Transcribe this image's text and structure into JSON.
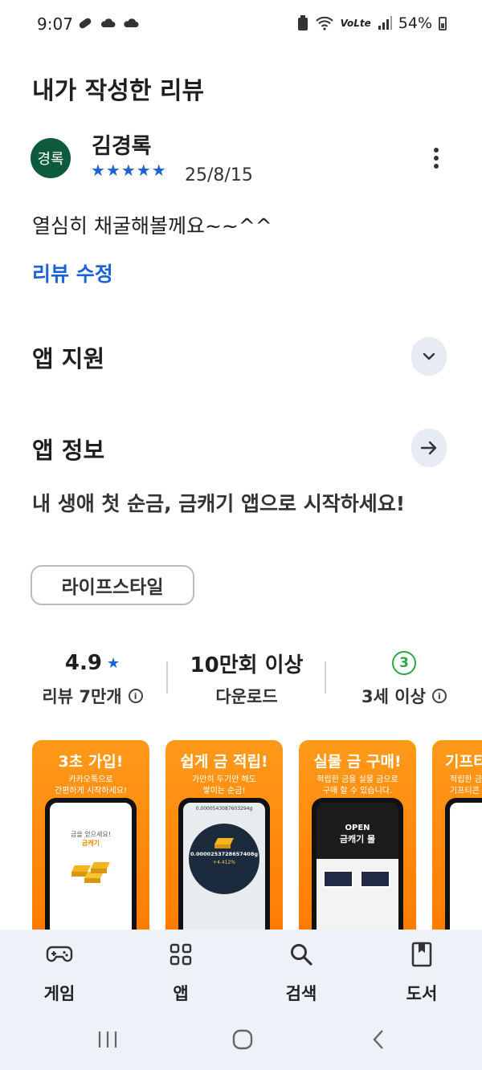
{
  "status_bar": {
    "time": "9:07",
    "network": "VoLte",
    "battery": "54%"
  },
  "page_title": "내가 작성한 리뷰",
  "review": {
    "avatar_text": "경록",
    "reviewer": "김경록",
    "rating": 5,
    "stars": "★★★★★",
    "date": "25/8/15",
    "text": "열심히 채굴해볼께요~~^^",
    "edit_label": "리뷰 수정"
  },
  "app_support": {
    "title": "앱 지원"
  },
  "app_info": {
    "title": "앱 정보",
    "description": "내 생애 첫 순금, 금캐기 앱으로 시작하세요!",
    "category": "라이프스타일"
  },
  "stats": {
    "rating": "4.9",
    "reviews": "리뷰 7만개",
    "downloads": "10만회 이상",
    "downloads_label": "다운로드",
    "age_rating": "3",
    "age_label": "3세 이상"
  },
  "screenshots": [
    {
      "title": "3초 가입!",
      "sub1": "카카오톡으로",
      "sub2": "간편하게 시작하세요!",
      "screen_line1": "금을 얻으세요!",
      "screen_line2": "금캐기"
    },
    {
      "title": "쉽게 금 적립!",
      "sub1": "가만히 두기만 해도",
      "sub2": "쌓이는 순금!",
      "screen_top": "0.0000543087603294g",
      "screen_value": "0.0000253728657408g",
      "screen_rate": "+4.412%"
    },
    {
      "title": "실물 금 구매!",
      "sub1": "적립한 금을 실물 금으로",
      "sub2": "구매 할 수 있습니다.",
      "screen_open": "OPEN",
      "screen_mall": "금캐기 몰"
    },
    {
      "title": "기프티",
      "sub1": "적립한 금",
      "sub2": "기프티콘"
    }
  ],
  "bottom_nav": [
    {
      "label": "게임",
      "icon": "gamepad-icon"
    },
    {
      "label": "앱",
      "icon": "apps-grid-icon"
    },
    {
      "label": "검색",
      "icon": "search-icon"
    },
    {
      "label": "도서",
      "icon": "book-icon"
    }
  ],
  "colors": {
    "accent": "#1a63d6",
    "avatar_bg": "#0e5a3d",
    "age_green": "#29a745",
    "nav_bg": "#eef1f7",
    "shot_orange": "#ff8a00"
  }
}
